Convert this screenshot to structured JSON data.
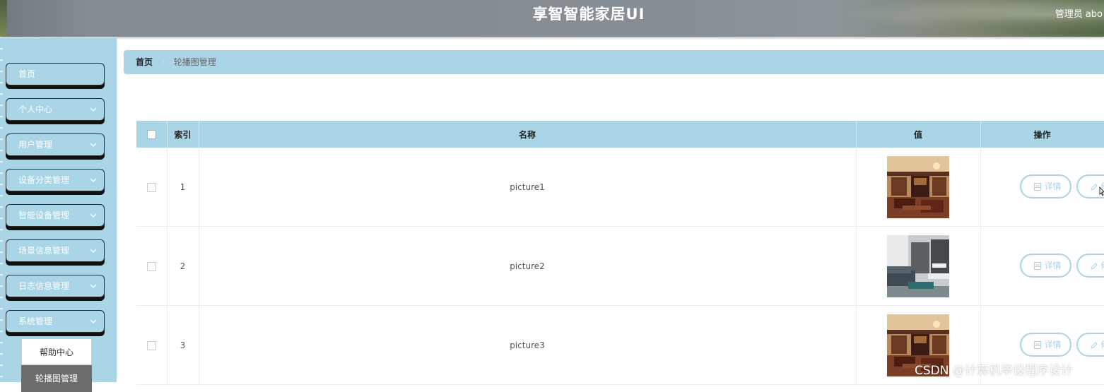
{
  "header": {
    "title": "享智智能家居UI",
    "user_label": "管理员 abo"
  },
  "sidebar": {
    "items": [
      {
        "label": "首页",
        "has_arrow": false
      },
      {
        "label": "个人中心",
        "has_arrow": true
      },
      {
        "label": "用户管理",
        "has_arrow": true
      },
      {
        "label": "设备分类管理",
        "has_arrow": true
      },
      {
        "label": "智能设备管理",
        "has_arrow": true
      },
      {
        "label": "场景信息管理",
        "has_arrow": true
      },
      {
        "label": "日志信息管理",
        "has_arrow": true
      },
      {
        "label": "系统管理",
        "has_arrow": true
      }
    ],
    "submenu": [
      {
        "label": "帮助中心"
      },
      {
        "label": "轮播图管理",
        "active": true
      }
    ]
  },
  "breadcrumb": {
    "home": "首页",
    "separator": "/",
    "current": "轮播图管理"
  },
  "table": {
    "headers": {
      "index": "索引",
      "name": "名称",
      "value": "值",
      "actions": "操作"
    },
    "rows": [
      {
        "index": "1",
        "name": "picture1",
        "image": "interior-wood-room"
      },
      {
        "index": "2",
        "name": "picture2",
        "image": "interior-grey-room"
      },
      {
        "index": "3",
        "name": "picture3",
        "image": "interior-wood-room"
      }
    ],
    "detail_label": "详情",
    "edit_label": "修"
  },
  "watermark": "CSDN @计算机毕设程序设计",
  "colors": {
    "accent": "#a9d5e7",
    "header": "#868e95",
    "submenu_active": "#6c6c6c"
  }
}
